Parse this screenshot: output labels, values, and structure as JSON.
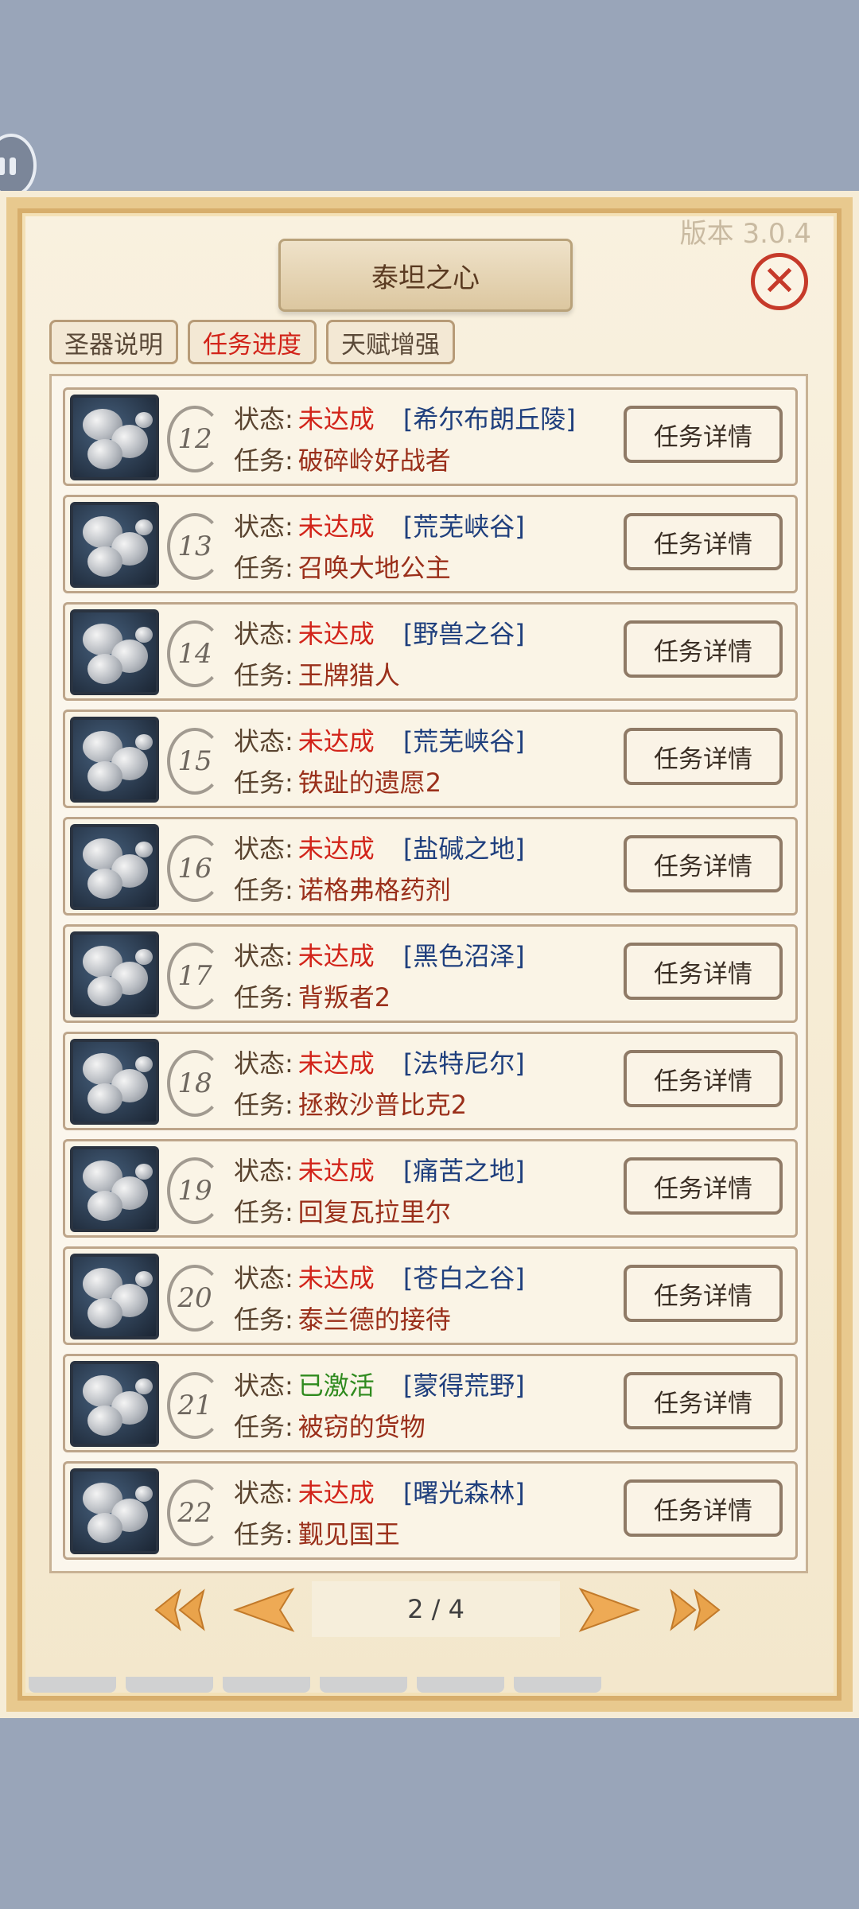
{
  "title": "泰坦之心",
  "version": "版本 3.0.4",
  "close_symbol": "✕",
  "tabs": [
    {
      "label": "圣器说明",
      "active": false
    },
    {
      "label": "任务进度",
      "active": true
    },
    {
      "label": "天赋增强",
      "active": false
    }
  ],
  "labels": {
    "status": "状态:",
    "task": "任务:",
    "detail_button": "任务详情"
  },
  "rows": [
    {
      "num": "12",
      "status": "未达成",
      "status_color": "#d2241a",
      "location": "[希尔布朗丘陵]",
      "task": "破碎岭好战者"
    },
    {
      "num": "13",
      "status": "未达成",
      "status_color": "#d2241a",
      "location": "[荒芜峡谷]",
      "task": "召唤大地公主"
    },
    {
      "num": "14",
      "status": "未达成",
      "status_color": "#d2241a",
      "location": "[野兽之谷]",
      "task": "王牌猎人"
    },
    {
      "num": "15",
      "status": "未达成",
      "status_color": "#d2241a",
      "location": "[荒芜峡谷]",
      "task": "铁趾的遗愿2"
    },
    {
      "num": "16",
      "status": "未达成",
      "status_color": "#d2241a",
      "location": "[盐碱之地]",
      "task": "诺格弗格药剂"
    },
    {
      "num": "17",
      "status": "未达成",
      "status_color": "#d2241a",
      "location": "[黑色沼泽]",
      "task": "背叛者2"
    },
    {
      "num": "18",
      "status": "未达成",
      "status_color": "#d2241a",
      "location": "[法特尼尔]",
      "task": "拯救沙普比克2"
    },
    {
      "num": "19",
      "status": "未达成",
      "status_color": "#d2241a",
      "location": "[痛苦之地]",
      "task": "回复瓦拉里尔"
    },
    {
      "num": "20",
      "status": "未达成",
      "status_color": "#d2241a",
      "location": "[苍白之谷]",
      "task": "泰兰德的接待"
    },
    {
      "num": "21",
      "status": "已激活",
      "status_color": "#2f8a1e",
      "location": "[蒙得荒野]",
      "task": "被窃的货物"
    },
    {
      "num": "22",
      "status": "未达成",
      "status_color": "#d2241a",
      "location": "[曙光森林]",
      "task": "觐见国王"
    }
  ],
  "pagination": {
    "text": "2 / 4"
  },
  "colors": {
    "accent_red": "#d2241a",
    "active_green": "#2f8a1e",
    "location_blue": "#1f3f7d"
  }
}
